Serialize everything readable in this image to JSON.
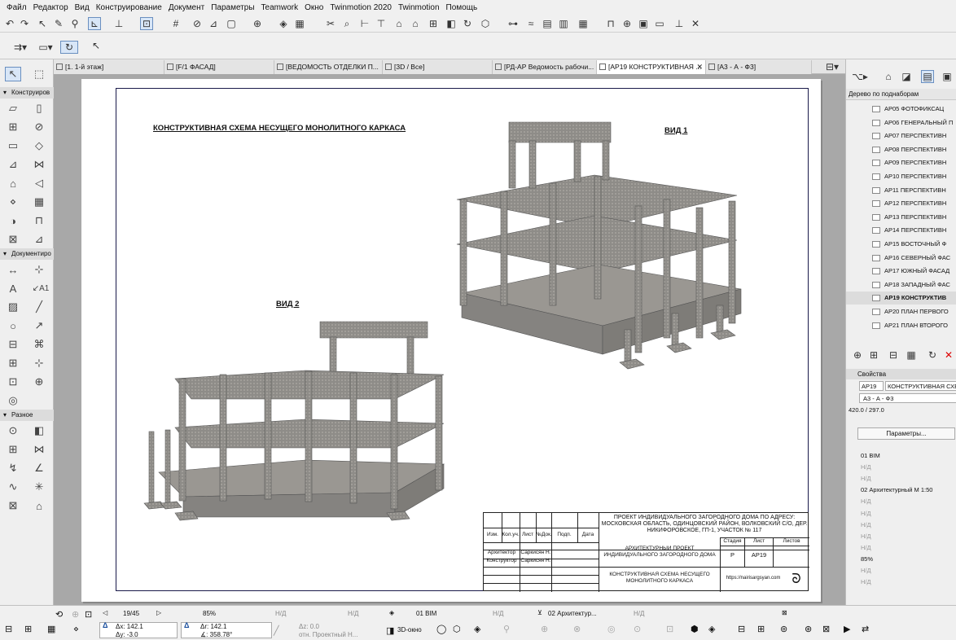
{
  "menu": [
    "Файл",
    "Редактор",
    "Вид",
    "Конструирование",
    "Документ",
    "Параметры",
    "Teamwork",
    "Окно",
    "Twinmotion 2020",
    "Twinmotion",
    "Помощь"
  ],
  "toolbox": {
    "sections": [
      "Конструиров",
      "Документиро",
      "Разное"
    ]
  },
  "tabs": [
    {
      "label": "[1. 1-й этаж]"
    },
    {
      "label": "[F/1 ФАСАД]"
    },
    {
      "label": "[ВЕДОМОСТЬ ОТДЕЛКИ П..."
    },
    {
      "label": "[3D / Все]"
    },
    {
      "label": "[РД-АР Ведомость рабочи..."
    },
    {
      "label": "[АР19 КОНСТРУКТИВНАЯ ..."
    },
    {
      "label": "[А3 - А - Ф3]"
    }
  ],
  "sheet": {
    "title": "КОНСТРУКТИВНАЯ СХЕМА НЕСУЩЕГО МОНОЛИТНОГО КАРКАСА",
    "view1": "ВИД 1",
    "view2": "ВИД 2",
    "stamp": {
      "project": "ПРОЕКТ ИНДИВИДУАЛЬНОГО ЗАГОРОДНОГО ДОМА ПО АДРЕСУ: МОСКОВСКАЯ ОБЛАСТЬ, ОДИНЦОВСКИЙ РАЙОН, ВОЛКОВСКИЙ С/О, ДЕР. НИКИФОРОВСКОЕ, ГП-1, УЧАСТОК № 117",
      "col_izm": "Изм.",
      "col_kol": "Кол.уч.",
      "col_list": "Лист",
      "col_ndok": "№Док.",
      "col_podp": "Подп.",
      "col_date": "Дата",
      "role1": "Архитектор",
      "name1": "Саркисян Н.",
      "role2": "Конструктор",
      "name2": "Саркисян Н.",
      "section": "АРХИТЕКТУРНЫЙ ПРОЕКТ ИНДИВИДУАЛЬНОГО ЗАГОРОДНОГО ДОМА",
      "stage_lbl": "Стадия",
      "sheet_lbl": "Лист",
      "sheets_lbl": "Листов",
      "stage": "Р",
      "sheet_no": "АР19",
      "drawing": "КОНСТРУКТИВНАЯ СХЕМА НЕСУЩЕГО МОНОЛИТНОГО КАРКАСА",
      "site": "https://nairisargsyan.com"
    }
  },
  "navigator": {
    "mode": "Дерево по поднаборам",
    "items": [
      {
        "label": "АР05 ФОТОФИКСАЦ",
        "sel": false
      },
      {
        "label": "АР06 ГЕНЕРАЛЬНЫЙ П",
        "sel": false
      },
      {
        "label": "АР07 ПЕРСПЕКТИВН",
        "sel": false
      },
      {
        "label": "АР08 ПЕРСПЕКТИВН",
        "sel": false
      },
      {
        "label": "АР09 ПЕРСПЕКТИВН",
        "sel": false
      },
      {
        "label": "АР10 ПЕРСПЕКТИВН",
        "sel": false
      },
      {
        "label": "АР11 ПЕРСПЕКТИВН",
        "sel": false
      },
      {
        "label": "АР12 ПЕРСПЕКТИВН",
        "sel": false
      },
      {
        "label": "АР13 ПЕРСПЕКТИВН",
        "sel": false
      },
      {
        "label": "АР14 ПЕРСПЕКТИВН",
        "sel": false
      },
      {
        "label": "АР15 ВОСТОЧНЫЙ Ф",
        "sel": false
      },
      {
        "label": "АР16 СЕВЕРНЫЙ ФАС",
        "sel": false
      },
      {
        "label": "АР17 ЮЖНЫЙ ФАСАД",
        "sel": false
      },
      {
        "label": "АР18 ЗАПАДНЫЙ ФАС",
        "sel": false
      },
      {
        "label": "АР19 КОНСТРУКТИВ",
        "sel": true
      },
      {
        "label": "АР20 ПЛАН ПЕРВОГО",
        "sel": false
      },
      {
        "label": "АР21 ПЛАН ВТОРОГО",
        "sel": false
      }
    ]
  },
  "properties": {
    "header": "Свойства",
    "id": "АР19",
    "name": "КОНСТРУКТИВНАЯ СХЕ",
    "layout": "А3 - А - Ф3",
    "size": "420.0 / 297.0",
    "button": "Параметры...",
    "rows": [
      "01 BIM",
      "Н/Д",
      "Н/Д",
      "02 Архитектурный М 1:50",
      "Н/Д",
      "Н/Д",
      "Н/Д",
      "Н/Д",
      "Н/Д",
      "85%",
      "Н/Д",
      "Н/Д"
    ]
  },
  "status": {
    "page": "19/45",
    "zoom": "85%",
    "nd1": "Н/Д",
    "nd2": "Н/Д",
    "layer": "01 BIM",
    "nd3": "Н/Д",
    "arch": "02 Архитектур...",
    "nd4": "Н/Д",
    "dx": "Δx: 142.1",
    "dy": "Δy: -3.0",
    "dx2": "Δr: 142.1",
    "ang": "∡: 358.78°",
    "dz": "Δz: 0.0",
    "rel": "отн. Проектный Н...",
    "view3d": "3D-окно"
  }
}
